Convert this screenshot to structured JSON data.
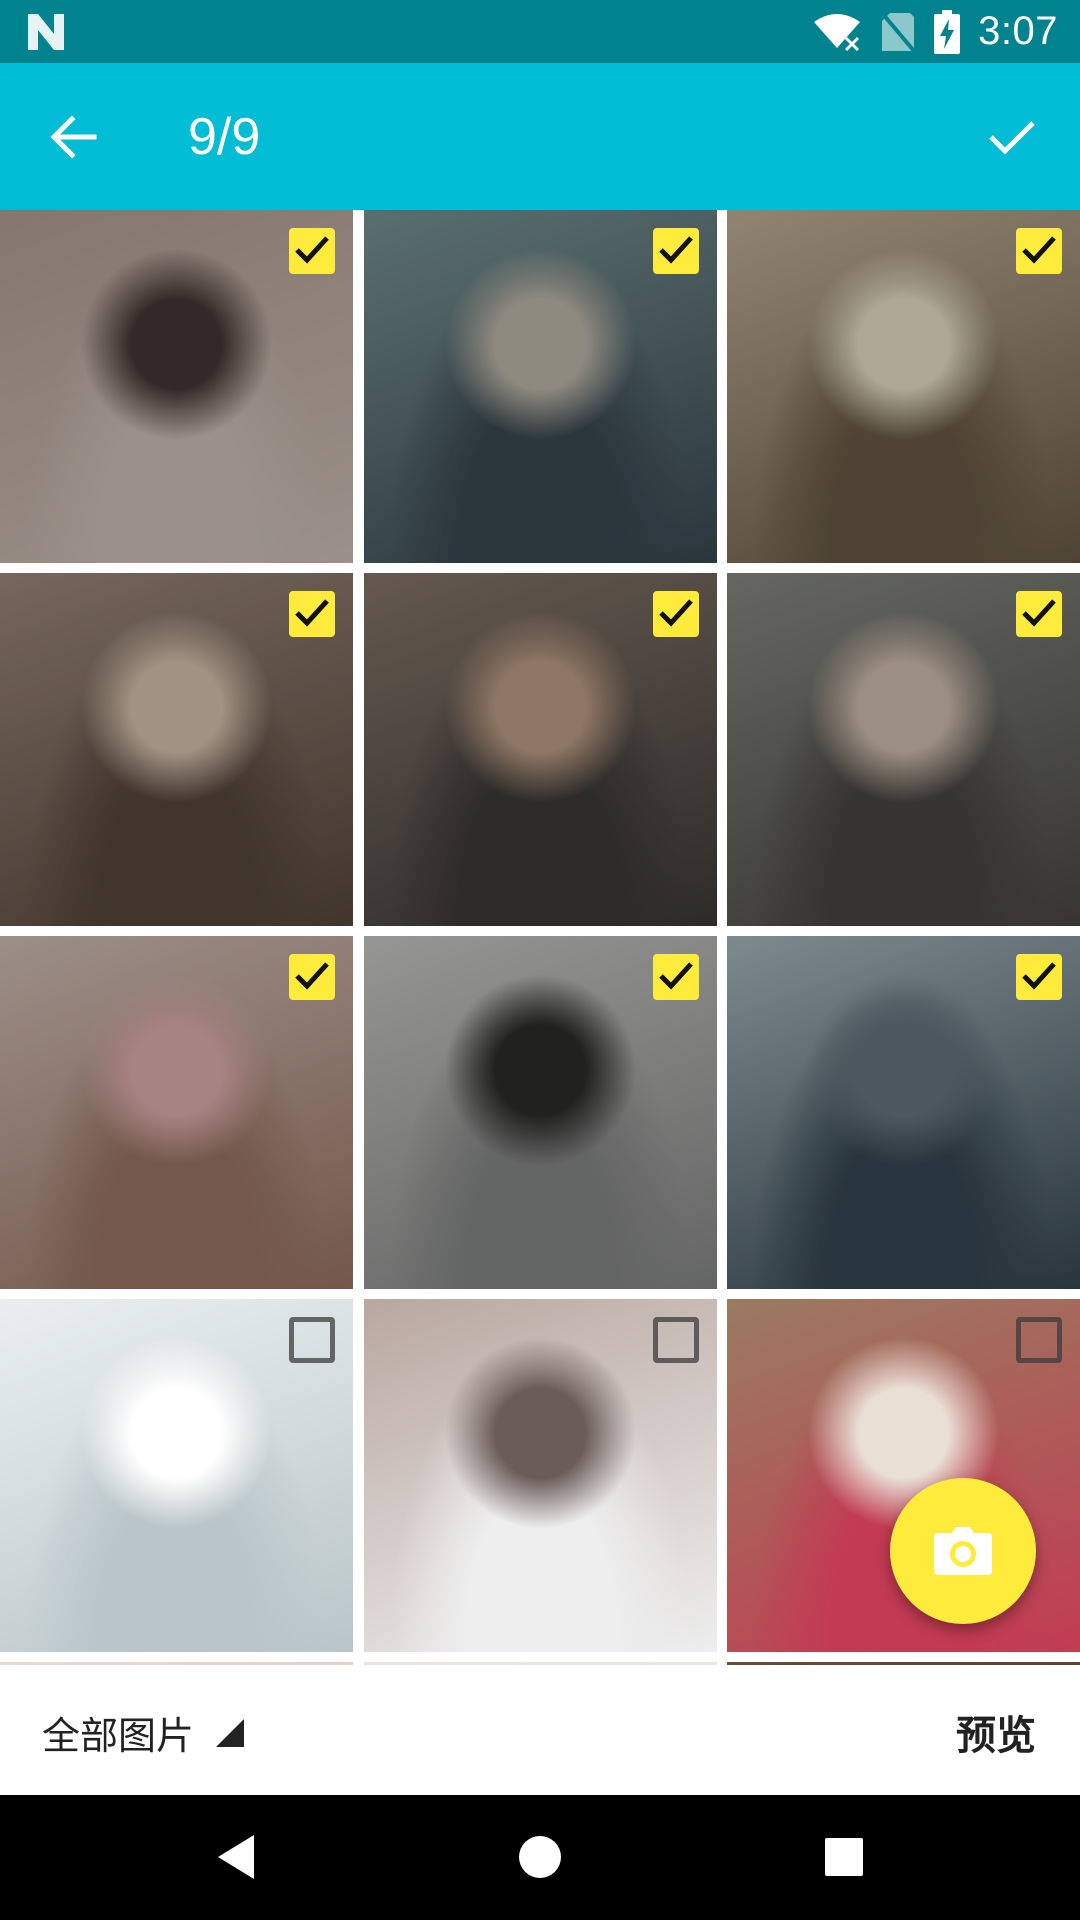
{
  "status_bar": {
    "time": "3:07",
    "icons": [
      "android-n-logo-icon",
      "wifi-off-icon",
      "no-sim-icon",
      "battery-charging-icon"
    ]
  },
  "app_bar": {
    "back_icon": "arrow-left-icon",
    "title": "9/9",
    "done_icon": "checkmark-icon"
  },
  "grid": {
    "tiles": [
      {
        "selected": true,
        "colors": [
          "#b9a59a",
          "#4a3a36",
          "#d7c8bf"
        ]
      },
      {
        "selected": true,
        "colors": [
          "#7f9a9a",
          "#c7c0b2",
          "#3c4b55"
        ]
      },
      {
        "selected": true,
        "colors": [
          "#c9b79e",
          "#f2e9cf",
          "#6d5e49"
        ]
      },
      {
        "selected": true,
        "colors": [
          "#a48e80",
          "#e1cbb7",
          "#5a4a3f"
        ]
      },
      {
        "selected": true,
        "colors": [
          "#8c7b6e",
          "#c6a58c",
          "#3f3d3a"
        ]
      },
      {
        "selected": true,
        "colors": [
          "#8c8f86",
          "#d9c5b4",
          "#4d4a45"
        ]
      },
      {
        "selected": true,
        "colors": [
          "#d9c6bd",
          "#e8b6b6",
          "#a07a68"
        ]
      },
      {
        "selected": true,
        "colors": [
          "#cfd0cb",
          "#2f2e2c",
          "#8b8d8c"
        ]
      },
      {
        "selected": true,
        "colors": [
          "#aebfc5",
          "#6c7b86",
          "#3a4a56"
        ]
      },
      {
        "selected": false,
        "colors": [
          "#e9eff1",
          "#ffffff",
          "#b9c5c8"
        ]
      },
      {
        "selected": false,
        "colors": [
          "#b9a7a0",
          "#6b5c58",
          "#eeeeee"
        ]
      },
      {
        "selected": false,
        "colors": [
          "#9a7b60",
          "#e9dfd5",
          "#c23b52"
        ]
      },
      {
        "selected": false,
        "colors": [
          "#e8d8d0",
          "#f3ebe6",
          "#d7c0b7"
        ]
      },
      {
        "selected": false,
        "colors": [
          "#ece2dc",
          "#d8c3b8",
          "#f6eee8"
        ]
      },
      {
        "selected": false,
        "colors": [
          "#6a4d35",
          "#c39b73",
          "#3c2a1e"
        ]
      }
    ]
  },
  "fab": {
    "icon": "camera-icon",
    "color": "#ffeb3b"
  },
  "bottom_bar": {
    "folder_label": "全部图片",
    "folder_icon": "dropdown-triangle-icon",
    "preview_label": "预览"
  },
  "nav_bar": {
    "icons": [
      "back-triangle-icon",
      "home-circle-icon",
      "recents-square-icon"
    ]
  },
  "colors": {
    "status_bar": "#00838f",
    "app_bar": "#00bcd4",
    "accent": "#ffeb3b"
  }
}
